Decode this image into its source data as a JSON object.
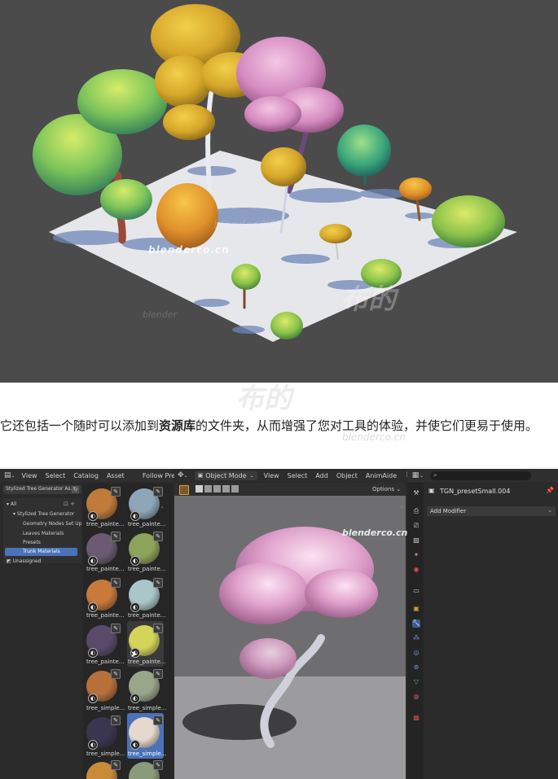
{
  "watermarks": {
    "site": "blenderco.cn",
    "brand": "布的",
    "faint_center": "blender布的",
    "faint_small": "blender"
  },
  "paragraph": {
    "part1": "它还包括一个随时可以添加到",
    "bold": "资源库",
    "part2": "的文件夹，从而增强了您对工具的体验，并使它们更易于使用。"
  },
  "asset_browser": {
    "header_menus": [
      "View",
      "Select",
      "Catalog",
      "Asset"
    ],
    "follow_prefs": "Follow Prefer",
    "library_name": "Stylized Tree Generator As...",
    "catalog_tree": [
      {
        "label": "All",
        "level": 0
      },
      {
        "label": "Stylized Tree Generator",
        "level": 1
      },
      {
        "label": "Geometry Nodes Set Up",
        "level": 2
      },
      {
        "label": "Leaves Materials",
        "level": 2
      },
      {
        "label": "Presets",
        "level": 2
      },
      {
        "label": "Trunk Materials",
        "level": 2,
        "selected": true
      },
      {
        "label": "Unassigned",
        "level": 0
      }
    ],
    "assets": [
      {
        "label": "tree_painte...",
        "color": "#c07a3a"
      },
      {
        "label": "tree_painte...",
        "color": "#8fa6b8"
      },
      {
        "label": "tree_painte...",
        "color": "#6b5a72"
      },
      {
        "label": "tree_painte...",
        "color": "#8ea35a"
      },
      {
        "label": "tree_painte...",
        "color": "#c9793a"
      },
      {
        "label": "tree_painte...",
        "color": "#a9c6c9"
      },
      {
        "label": "tree_painte...",
        "color": "#5a4a6a"
      },
      {
        "label": "tree_painte...",
        "color": "#d4d45a"
      },
      {
        "label": "tree_simple...",
        "color": "#b8703a"
      },
      {
        "label": "tree_simple...",
        "color": "#9aa58a"
      },
      {
        "label": "tree_simple...",
        "color": "#3a3550"
      },
      {
        "label": "tree_simple...",
        "color": "#e6d8cc"
      },
      {
        "label": "",
        "color": "#c98a3a"
      },
      {
        "label": "",
        "color": "#8a9a7a"
      }
    ]
  },
  "viewport": {
    "mode": "Object Mode",
    "menus": [
      "View",
      "Select",
      "Add",
      "Object",
      "AnimAide"
    ],
    "options": "Options",
    "watermark": "blenderco.cn"
  },
  "properties": {
    "object_name": "TGN_presetSmall.004",
    "add_modifier": "Add Modifier",
    "search_placeholder": ""
  },
  "colors": {
    "selection_blue": "#4a72b8",
    "panel_bg": "#2a2a2a",
    "viewport_bg": "#6e6e70"
  }
}
